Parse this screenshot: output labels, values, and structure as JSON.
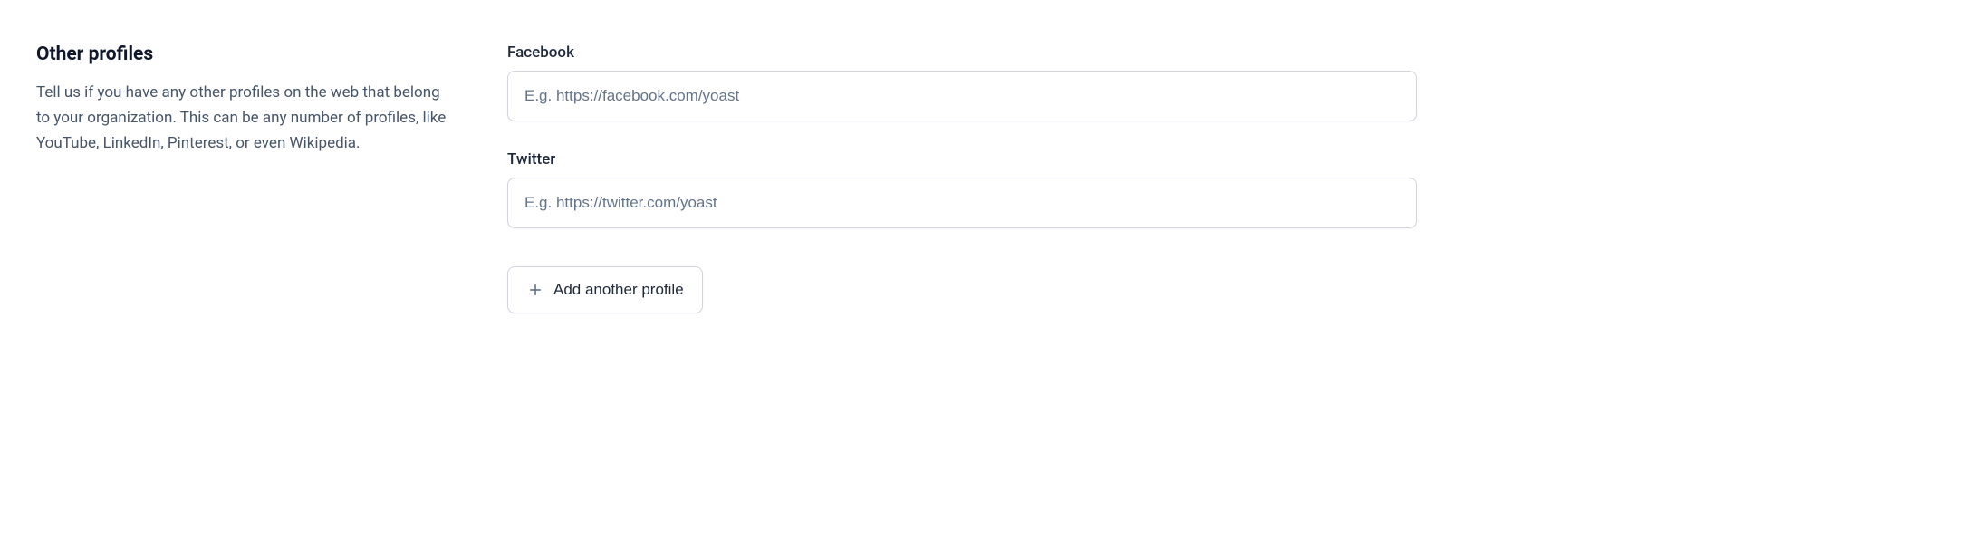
{
  "section": {
    "title": "Other profiles",
    "description": "Tell us if you have any other profiles on the web that belong to your organization. This can be any number of profiles, like YouTube, LinkedIn, Pinterest, or even Wikipedia."
  },
  "fields": {
    "facebook": {
      "label": "Facebook",
      "placeholder": "E.g. https://facebook.com/yoast",
      "value": ""
    },
    "twitter": {
      "label": "Twitter",
      "placeholder": "E.g. https://twitter.com/yoast",
      "value": ""
    }
  },
  "addButton": {
    "label": "Add another profile"
  }
}
